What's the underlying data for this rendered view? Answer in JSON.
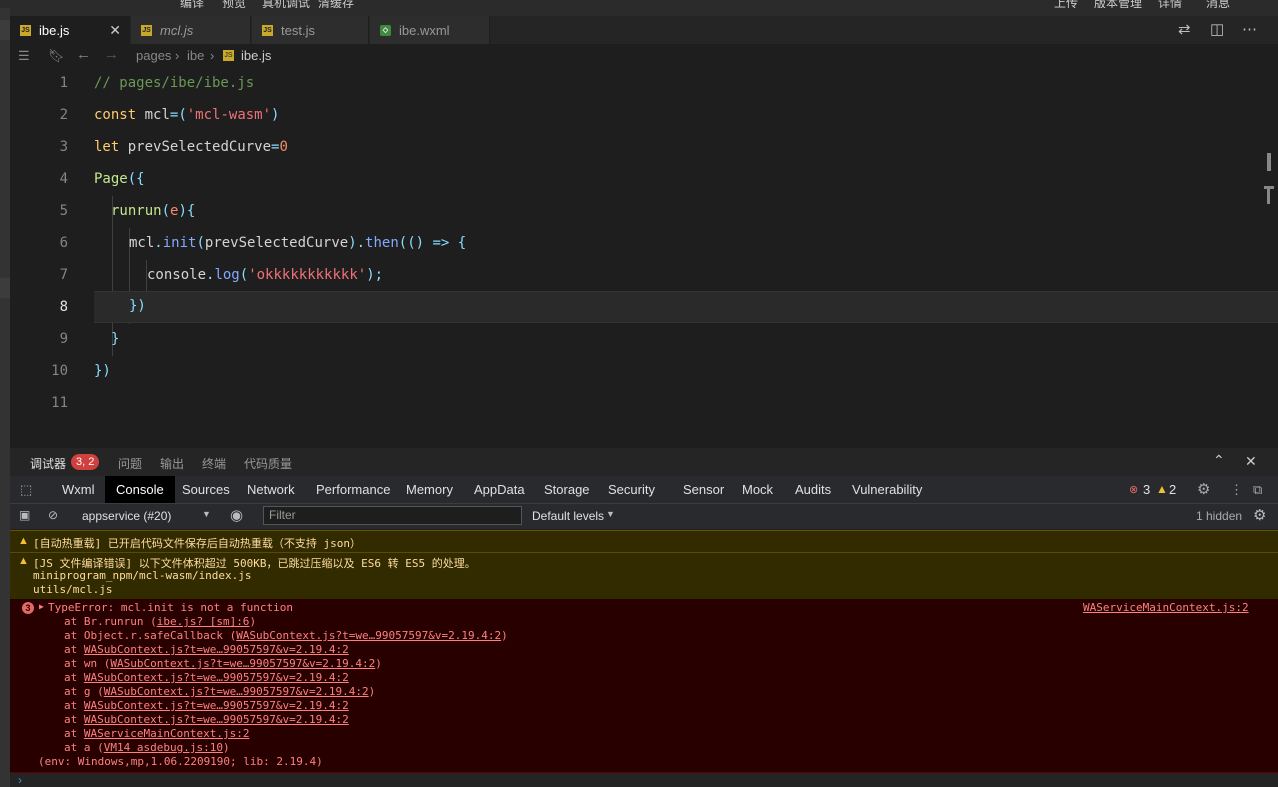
{
  "top_menu": {
    "items": [
      "编译",
      "预览",
      "真机调试",
      "清缓存",
      "上传",
      "版本管理",
      "详情",
      "消息"
    ]
  },
  "tabs": [
    {
      "label": "ibe.js",
      "icon": "JS",
      "active": true
    },
    {
      "label": "mcl.js",
      "icon": "JS",
      "active": false
    },
    {
      "label": "test.js",
      "icon": "JS",
      "active": false
    },
    {
      "label": "ibe.wxml",
      "icon": "wxml",
      "active": false
    }
  ],
  "tab_close": "✕",
  "breadcrumb": {
    "parts": [
      "pages",
      "ibe"
    ],
    "sep": "›",
    "file": "ibe.js"
  },
  "line_numbers": [
    "1",
    "2",
    "3",
    "4",
    "5",
    "6",
    "7",
    "8",
    "9",
    "10",
    "11"
  ],
  "code": {
    "l1": "// pages/ibe/ibe.js",
    "l2_kw": "const",
    "l2_var": "mcl",
    "l2_eq": "=(",
    "l2_str": "'mcl-wasm'",
    "l2_end": ")",
    "l3_kw": "let",
    "l3_var": "prevSelectedCurve",
    "l3_eq": "=",
    "l3_num": "0",
    "l4_fn": "Page",
    "l4_br": "({",
    "l5_fn": "runrun",
    "l5_p": "(",
    "l5_arg": "e",
    "l5_end": "){",
    "l6_obj": "mcl",
    "l6_dot": ".",
    "l6_fn": "init",
    "l6_p": "(",
    "l6_arg": "prevSelectedCurve",
    "l6_p2": ").",
    "l6_then": "then",
    "l6_rest": "(() => {",
    "l7_obj": "console",
    "l7_dot": ".",
    "l7_fn": "log",
    "l7_p": "(",
    "l7_str": "'okkkkkkkkkkk'",
    "l7_end": ");",
    "l8": "})",
    "l9": "}",
    "l10": "})"
  },
  "devtools_header": {
    "title": "调试器",
    "badge": "3, 2",
    "tabs": [
      "问题",
      "输出",
      "终端",
      "代码质量"
    ]
  },
  "devtools_tabs": [
    "Wxml",
    "Console",
    "Sources",
    "Network",
    "Performance",
    "Memory",
    "AppData",
    "Storage",
    "Security",
    "Sensor",
    "Mock",
    "Audits",
    "Vulnerability"
  ],
  "devtools_active": "Console",
  "counts": {
    "errors": "3",
    "warnings": "2"
  },
  "console_bar": {
    "context": "appservice (#20)",
    "filter_placeholder": "Filter",
    "levels": "Default levels",
    "hidden": "1 hidden"
  },
  "warnings": [
    {
      "text": "[自动热重载] 已开启代码文件保存后自动热重载（不支持 json）"
    },
    {
      "text": "[JS 文件编译错误] 以下文件体积超过 500KB，已跳过压缩以及 ES6 转 ES5 的处理。",
      "files": [
        "miniprogram_npm/mcl-wasm/index.js",
        "utils/mcl.js"
      ]
    }
  ],
  "error": {
    "count": "3",
    "message": "TypeError: mcl.init is not a function",
    "source": "WAServiceMainContext.js:2",
    "stack": [
      {
        "pre": "at Br.runrun (",
        "link": "ibe.js? [sm]:6",
        "post": ")"
      },
      {
        "pre": "at Object.r.safeCallback (",
        "link": "WASubContext.js?t=we…99057597&v=2.19.4:2",
        "post": ")"
      },
      {
        "pre": "at ",
        "link": "WASubContext.js?t=we…99057597&v=2.19.4:2",
        "post": ""
      },
      {
        "pre": "at wn (",
        "link": "WASubContext.js?t=we…99057597&v=2.19.4:2",
        "post": ")"
      },
      {
        "pre": "at ",
        "link": "WASubContext.js?t=we…99057597&v=2.19.4:2",
        "post": ""
      },
      {
        "pre": "at g (",
        "link": "WASubContext.js?t=we…99057597&v=2.19.4:2",
        "post": ")"
      },
      {
        "pre": "at ",
        "link": "WASubContext.js?t=we…99057597&v=2.19.4:2",
        "post": ""
      },
      {
        "pre": "at ",
        "link": "WASubContext.js?t=we…99057597&v=2.19.4:2",
        "post": ""
      },
      {
        "pre": "at ",
        "link": "WAServiceMainContext.js:2",
        "post": ""
      },
      {
        "pre": "at a (",
        "link": "VM14 asdebug.js:10",
        "post": ")"
      }
    ],
    "env": "(env: Windows,mp,1.06.2209190; lib: 2.19.4)"
  },
  "prompt": "›",
  "colors": {
    "editor_bg": "#1e1e1e",
    "warn_bg": "#332b00",
    "error_bg": "#290000",
    "badge": "#d0403e"
  }
}
